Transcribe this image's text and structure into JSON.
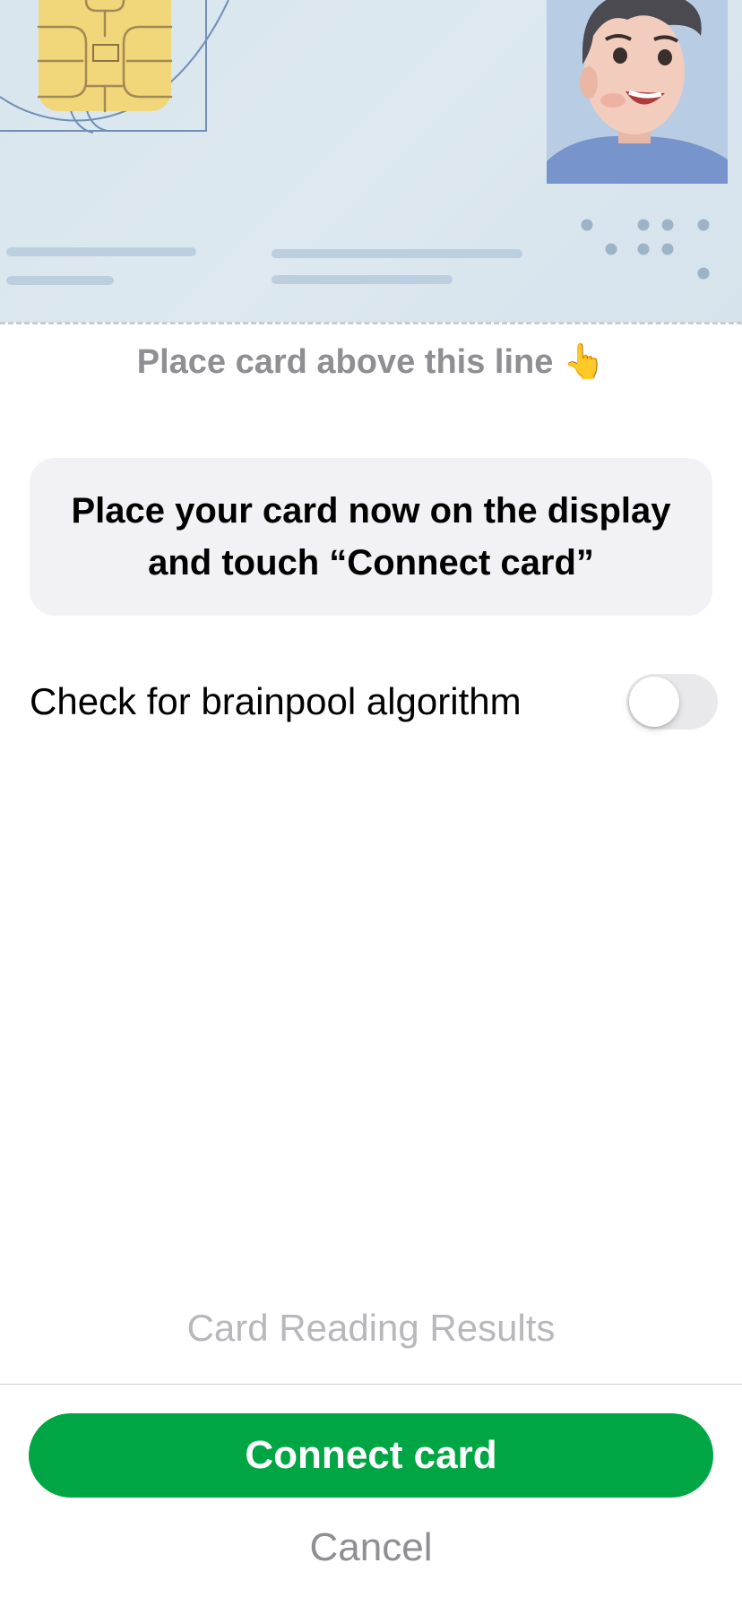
{
  "card_hint": {
    "text": "Place card above this line",
    "emoji": "👆"
  },
  "instruction": {
    "text": "Place your card now on the display and touch “Connect card”"
  },
  "brainpool_option": {
    "label": "Check for brainpool algorithm",
    "enabled": false
  },
  "results_link": {
    "label": "Card Reading Results"
  },
  "actions": {
    "connect_label": "Connect card",
    "cancel_label": "Cancel"
  },
  "colors": {
    "accent": "#00a643",
    "card_background": "#dae6ee",
    "chip": "#f1d67a",
    "muted_text": "#8e8e93"
  },
  "icons": {
    "hint": "pointing-up-hand-emoji",
    "chip": "card-chip-icon",
    "portrait": "person-portrait-icon"
  }
}
